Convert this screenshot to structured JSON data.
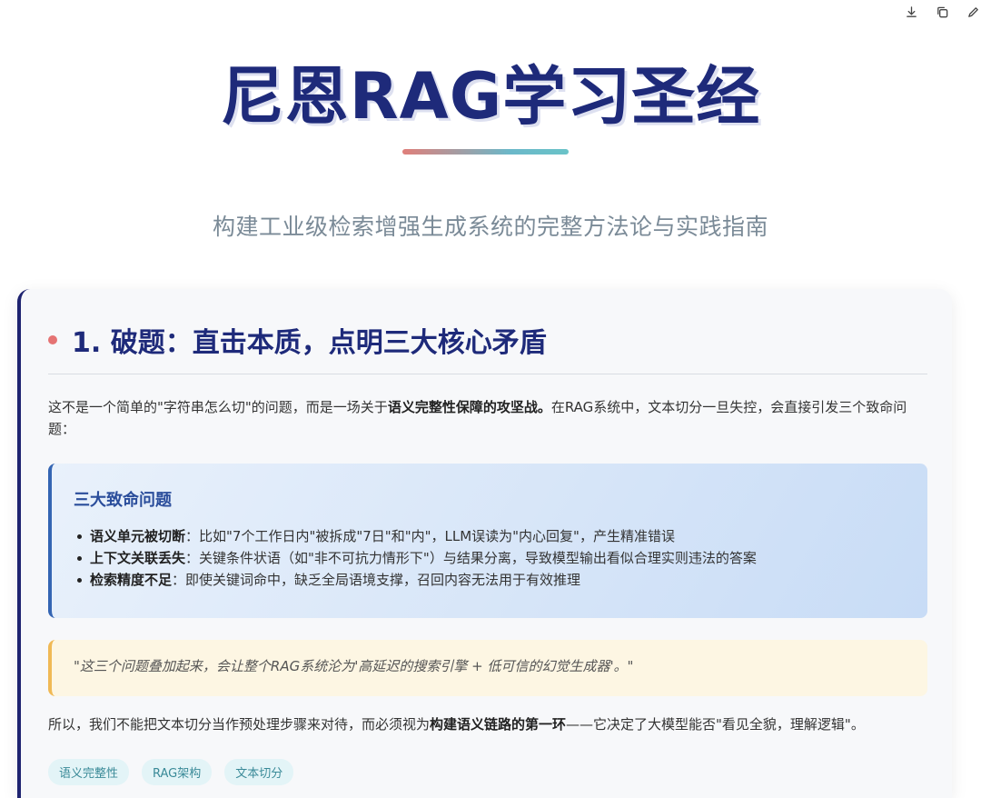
{
  "toolbar": {
    "download_icon": "download-icon",
    "copy_icon": "copy-icon",
    "edit_icon": "edit-icon"
  },
  "header": {
    "title": "尼恩RAG学习圣经",
    "subtitle": "构建工业级检索增强生成系统的完整方法论与实践指南"
  },
  "section": {
    "title": "1. 破题：直击本质，点明三大核心矛盾",
    "intro_part1": "这不是一个简单的\"字符串怎么切\"的问题，而是一场关于",
    "intro_bold": "语义完整性保障的攻坚战。",
    "intro_part2": "在RAG系统中，文本切分一旦失控，会直接引发三个致命问题：",
    "problems_title": "三大致命问题",
    "problems": [
      {
        "name": "语义单元被切断",
        "desc": "：比如\"7个工作日内\"被拆成\"7日\"和\"内\"，LLM误读为\"内心回复\"，产生精准错误"
      },
      {
        "name": "上下文关联丢失",
        "desc": "：关键条件状语（如\"非不可抗力情形下\"）与结果分离，导致模型输出看似合理实则违法的答案"
      },
      {
        "name": "检索精度不足",
        "desc": "：即使关键词命中，缺乏全局语境支撑，召回内容无法用于有效推理"
      }
    ],
    "quote": "\"这三个问题叠加起来，会让整个RAG系统沦为'高延迟的搜索引擎 + 低可信的幻觉生成器'。\"",
    "conclusion_part1": "所以，我们不能把文本切分当作预处理步骤来对待，而必须视为",
    "conclusion_bold": "构建语义链路的第一环",
    "conclusion_part2": "——它决定了大模型能否\"看见全貌，理解逻辑\"。",
    "tags": [
      "语义完整性",
      "RAG架构",
      "文本切分"
    ]
  },
  "colors": {
    "title": "#1e2a7a",
    "accent_red": "#e57373",
    "accent_teal": "#6bb8c9",
    "problem_border": "#3465b3",
    "quote_border": "#f0b955",
    "card_border": "#1e2370"
  }
}
